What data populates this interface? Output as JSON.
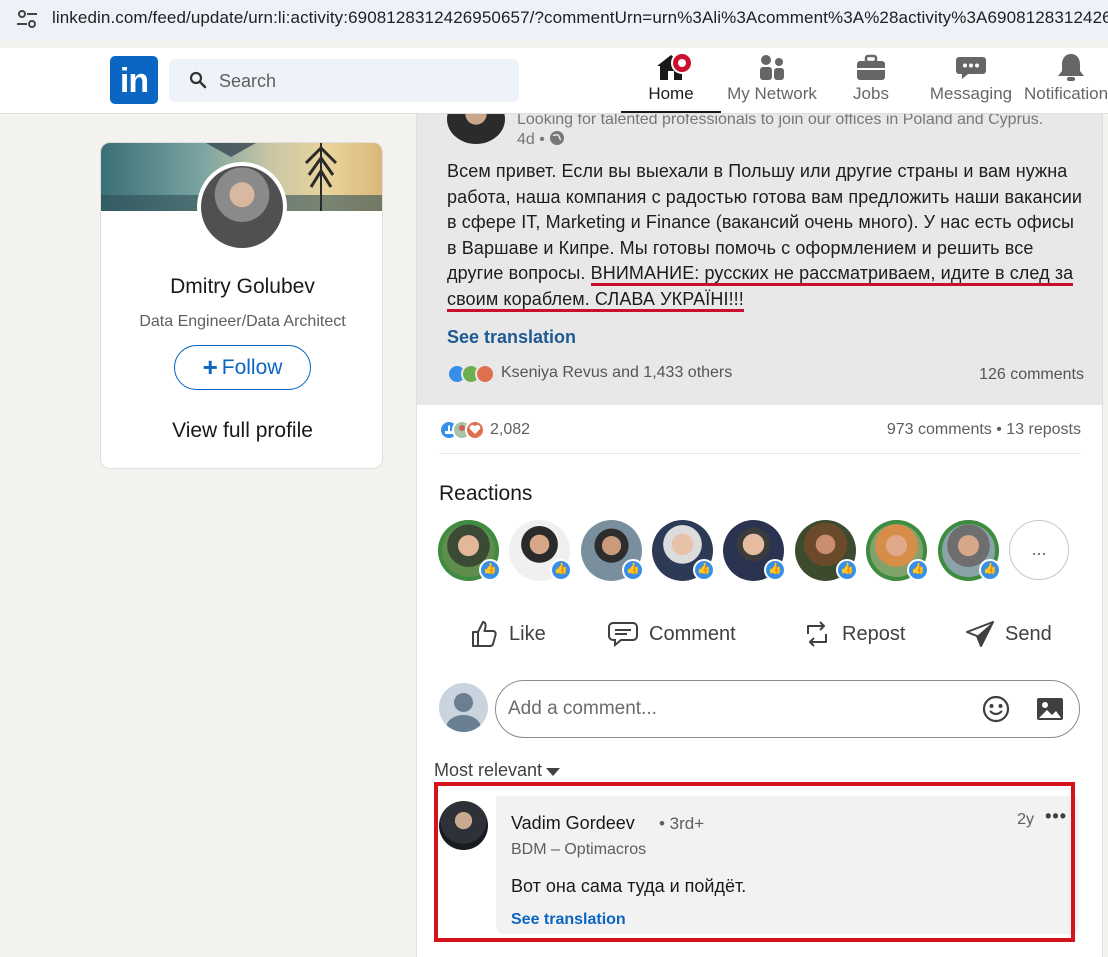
{
  "browser": {
    "url": "linkedin.com/feed/update/urn:li:activity:6908128312426950657/?commentUrn=urn%3Ali%3Acomment%3A%28activity%3A6908128312426"
  },
  "nav": {
    "logo_text": "in",
    "search_placeholder": "Search",
    "items": [
      {
        "label": "Home",
        "icon": "home-icon",
        "active": true
      },
      {
        "label": "My Network",
        "icon": "network-icon"
      },
      {
        "label": "Jobs",
        "icon": "briefcase-icon"
      },
      {
        "label": "Messaging",
        "icon": "messaging-icon"
      },
      {
        "label": "Notifications",
        "icon": "bell-icon"
      }
    ]
  },
  "profile_card": {
    "name": "Dmitry Golubev",
    "headline": "Data Engineer/Data Architect",
    "follow_label": "Follow",
    "view_profile_label": "View full profile"
  },
  "embedded_post": {
    "tagline": "Looking for talented professionals to join our offices in Poland and Cyprus.",
    "time": "4d •",
    "body_start": "Всем привет. Если вы выехали в Польшу или другие страны и вам нужна работа, наша компания с радостью готова вам предложить наши вакансии в сфере IT, Marketing и Finance (вакансий очень много). У нас есть офисы в Варшаве и Кипре. Мы готовы помочь с оформлением и решить все другие вопросы. ",
    "body_warning": "ВНИМАНИЕ: русских не рассматриваем, идите в след за своим кораблем. СЛАВА УКРАЇНІ!!!",
    "see_translation": "See translation",
    "reactions_text": "Kseniya Revus and 1,433 others",
    "comments_text": "126 comments"
  },
  "post": {
    "reaction_count": "2,082",
    "comments_reposts": "973 comments • 13 reposts",
    "reactions_title": "Reactions",
    "more_reactors": "...",
    "actions": {
      "like": "Like",
      "comment": "Comment",
      "repost": "Repost",
      "send": "Send"
    },
    "comment_placeholder": "Add a comment...",
    "sort_label": "Most relevant"
  },
  "comment": {
    "author": "Vadim Gordeev",
    "degree": "• 3rd+",
    "time": "2y",
    "more": "•••",
    "headline": "BDM – Optimacros",
    "text": "Вот она сама туда и пойдёт.",
    "see_translation": "See translation"
  },
  "colors": {
    "brand": "#0a66c2",
    "highlight": "#d4131b",
    "notification": "#cb112d"
  }
}
